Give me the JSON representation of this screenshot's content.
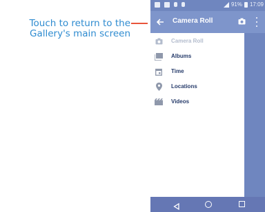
{
  "callout": {
    "line1": "Touch to return to the",
    "line2": "Gallery's main screen"
  },
  "status_bar": {
    "battery": "91%",
    "time": "17:09"
  },
  "app_bar": {
    "title": "Camera Roll",
    "icons": [
      "back-arrow-icon",
      "camera-icon",
      "more-vert-icon"
    ]
  },
  "drawer": {
    "items": [
      {
        "label": "Camera Roll",
        "icon": "camera-icon",
        "active": true
      },
      {
        "label": "Albums",
        "icon": "albums-icon",
        "active": false
      },
      {
        "label": "Time",
        "icon": "calendar-icon",
        "active": false
      },
      {
        "label": "Locations",
        "icon": "location-pin-icon",
        "active": false
      },
      {
        "label": "Videos",
        "icon": "film-icon",
        "active": false
      }
    ]
  },
  "nav_bar": {
    "icons": [
      "back-triangle-icon",
      "home-circle-icon",
      "recents-square-icon"
    ]
  },
  "colors": {
    "callout_text": "#2e8bd0",
    "leader_line": "#e8543a",
    "app_bar": "#7e95cb",
    "drawer_label": "#263b6a",
    "drawer_icon": "#8f98ab"
  }
}
